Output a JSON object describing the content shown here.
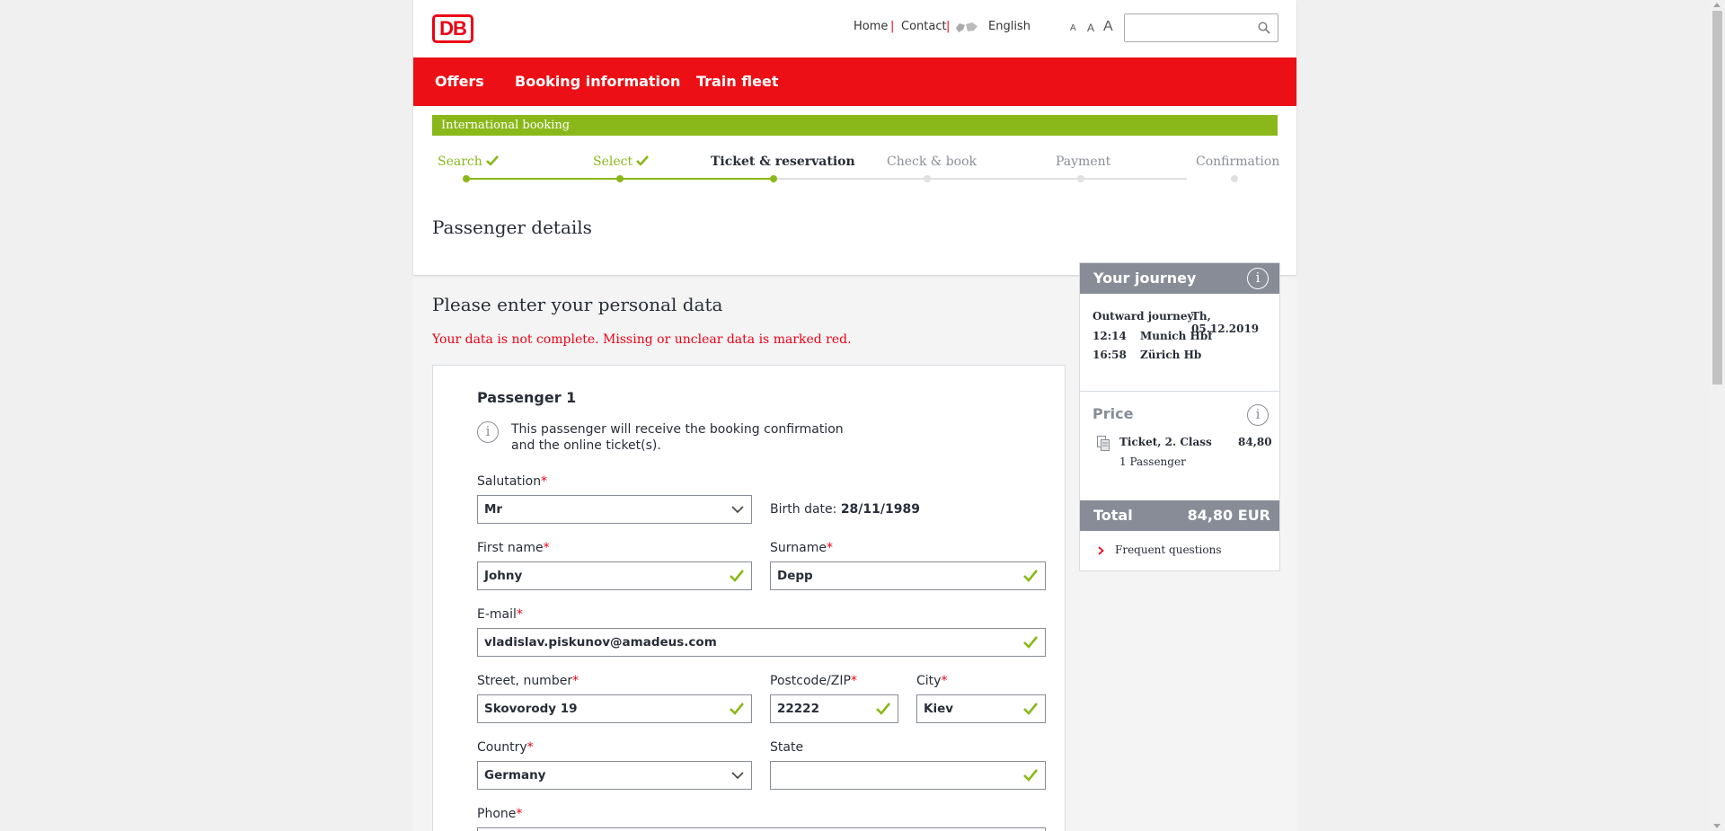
{
  "header": {
    "logo": "DB",
    "meta_links": [
      "Home",
      "Contact"
    ],
    "separator": "|",
    "language": "English",
    "font_sizes": [
      "A",
      "A",
      "A"
    ],
    "search_placeholder": ""
  },
  "main_nav": [
    "Offers",
    "Booking information",
    "Train fleet"
  ],
  "booking_bar": "International booking",
  "steps": [
    {
      "label": "Search",
      "state": "done"
    },
    {
      "label": "Select",
      "state": "done"
    },
    {
      "label": "Ticket & reservation",
      "state": "active"
    },
    {
      "label": "Check & book",
      "state": "todo"
    },
    {
      "label": "Payment",
      "state": "todo"
    },
    {
      "label": "Confirmation",
      "state": "todo"
    }
  ],
  "page_title": "Passenger details",
  "form": {
    "heading": "Please enter your personal data",
    "error": "Your data is not complete. Missing or unclear data is marked red.",
    "passenger_title": "Passenger 1",
    "info_line1": "This passenger will receive the booking confirmation",
    "info_line2": "and the online ticket(s).",
    "required_mark": "*",
    "salutation": {
      "label": "Salutation",
      "value": "Mr"
    },
    "birth_date": {
      "label": "Birth date:",
      "value": "28/11/1989"
    },
    "first_name": {
      "label": "First name",
      "value": "Johny"
    },
    "surname": {
      "label": "Surname",
      "value": "Depp"
    },
    "email": {
      "label": "E-mail",
      "value": "vladislav.piskunov@amadeus.com"
    },
    "street": {
      "label": "Street, number",
      "value": "Skovorody 19"
    },
    "postcode": {
      "label": "Postcode/ZIP",
      "value": "22222"
    },
    "city": {
      "label": "City",
      "value": "Kiev"
    },
    "country": {
      "label": "Country",
      "value": "Germany"
    },
    "state": {
      "label": "State",
      "value": ""
    },
    "phone": {
      "label": "Phone"
    }
  },
  "journey": {
    "title": "Your journey",
    "outward_label": "Outward journey",
    "outward_date": "Th, 05.12.2019",
    "dep_time": "12:14",
    "dep_station": "Munich Hbf",
    "arr_time": "16:58",
    "arr_station": "Zürich Hb",
    "price_title": "Price",
    "ticket_label": "Ticket, 2. Class",
    "ticket_price": "84,80",
    "passengers": "1 Passenger",
    "total_label": "Total",
    "total_value": "84,80 EUR",
    "faq": "Frequent questions"
  },
  "colors": {
    "db_red": "#ec1016",
    "success_green": "#8ab81a",
    "grey_header": "#878c96"
  }
}
